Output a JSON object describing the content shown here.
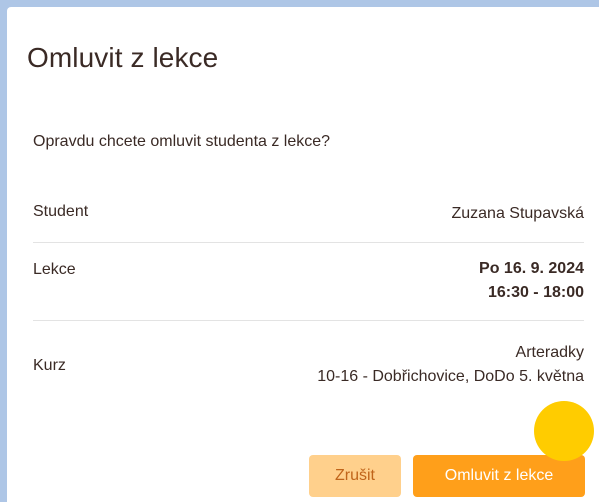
{
  "dialog": {
    "title": "Omluvit z lekce",
    "prompt": "Opravdu chcete omluvit studenta z lekce?",
    "rows": {
      "student": {
        "label": "Student",
        "value": "Zuzana Stupavská"
      },
      "lekce": {
        "label": "Lekce",
        "date": "Po 16. 9. 2024",
        "time": "16:30 - 18:00"
      },
      "kurz": {
        "label": "Kurz",
        "name": "Arteradky",
        "detail": "10-16 - Dobřichovice, DoDo 5. května"
      }
    },
    "buttons": {
      "cancel": "Zrušit",
      "confirm": "Omluvit z lekce"
    }
  },
  "colors": {
    "background": "#aec6e6",
    "primary": "#ff9f1a",
    "secondary": "#ffd08c",
    "text": "#3a2a25",
    "highlight": "#ffcc00"
  }
}
